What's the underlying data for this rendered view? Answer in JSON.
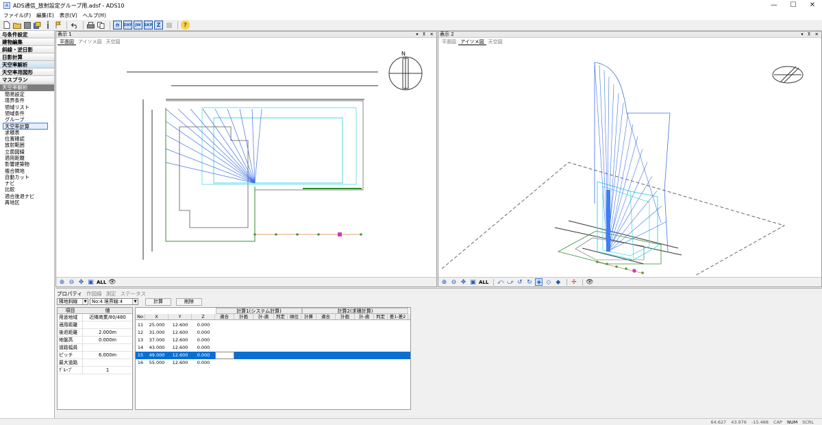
{
  "titlebar": {
    "title": "ADS通信_放射設定グループ用.adsf - ADS10",
    "app_icon": "A",
    "minimize": "—",
    "maximize": "☐",
    "close": "✕"
  },
  "menu": [
    "ファイル(F)",
    "編集(E)",
    "表示(V)",
    "ヘルプ(H)"
  ],
  "toolbar": {
    "icons": [
      "new-file-icon",
      "open-folder-icon",
      "save-icon",
      "save-as-icon",
      "info-icon",
      "flag-icon",
      "undo-icon",
      "print-icon",
      "copy-icon"
    ],
    "format_buttons": [
      "作",
      "DXF",
      "JW",
      "SKP",
      "Z"
    ],
    "help": "?"
  },
  "sidebar": {
    "categories": [
      "与条件設定",
      "建物編集",
      "斜線・逆日影",
      "日影計算",
      "天空率解析",
      "天空率用図形",
      "マスプラン"
    ],
    "active_category": "天空率解析",
    "section_title": "天空率解析",
    "items": [
      "簡易設定",
      "境界条件",
      "領域リスト",
      "領域条件",
      "グループ",
      "天空率計算",
      "求積表",
      "位置確認",
      "放射範囲",
      "立面図線",
      "適用距離",
      "影響建築物",
      "複合隣地",
      "自動カット",
      "ナビ",
      "比較",
      "適合後退ナビ",
      "再地区"
    ],
    "selected_item": "天空率計算"
  },
  "views": [
    {
      "title": "表示 1",
      "tabs": [
        "平面図",
        "アイソメ図",
        "天空図"
      ],
      "active_tab": "平面図",
      "controls": "▾ ⊼ ✕",
      "footer": [
        "zoom-in-icon",
        "zoom-out-icon",
        "pan-icon",
        "fit-icon"
      ],
      "footer_all": "ALL",
      "footer_eye": "eye-icon"
    },
    {
      "title": "表示 2",
      "tabs": [
        "平面図",
        "アイソメ図",
        "天空図"
      ],
      "active_tab": "アイソメ図",
      "controls": "▾ ⊼ ✕",
      "footer_all": "ALL"
    }
  ],
  "compass_label": "N",
  "bottom": {
    "tabs": [
      "プロパティ",
      "作図線",
      "測定",
      "ステータス"
    ],
    "active_tab": "プロパティ",
    "combo1": "隣地斜線",
    "combo2": "No:4 境界線:4",
    "calc_button": "計算",
    "delete_button": "削除",
    "props_header": [
      "項目",
      "値"
    ],
    "props": [
      {
        "k": "用途地域",
        "v": "近隣商業/80/480"
      },
      {
        "k": "適用距離",
        "v": ""
      },
      {
        "k": "後退距離",
        "v": "2.000m"
      },
      {
        "k": "地盤高",
        "v": "0.000m"
      },
      {
        "k": "道路幅員",
        "v": ""
      },
      {
        "k": "ピッチ",
        "v": "6.000m"
      },
      {
        "k": "最大道路",
        "v": ""
      },
      {
        "k": "ｸﾞﾙｰﾌﾟ",
        "v": "1"
      }
    ],
    "grid_groups": [
      "計算1(システム計算)",
      "計算2(求積計算)"
    ],
    "grid_headers": [
      "No",
      "X",
      "Y",
      "Z",
      "適合",
      "計画",
      "計-適",
      "判定",
      "順位",
      "計算",
      "適合",
      "計画",
      "計-適",
      "判定",
      "差1-差2"
    ],
    "grid_rows": [
      [
        "11",
        "25.000",
        "12.600",
        "0.000"
      ],
      [
        "12",
        "31.000",
        "12.600",
        "0.000"
      ],
      [
        "13",
        "37.000",
        "12.600",
        "0.000"
      ],
      [
        "14",
        "43.000",
        "12.600",
        "0.000"
      ],
      [
        "15",
        "49.000",
        "12.600",
        "0.000"
      ],
      [
        "16",
        "55.000",
        "12.600",
        "0.000"
      ]
    ],
    "selected_row_index": 4
  },
  "status": {
    "x": "64.627",
    "y": "43.976",
    "z": "-15.488",
    "cap": "CAP",
    "num": "NUM",
    "scrl": "SCRL"
  },
  "colors": {
    "accent": "#0a6fd1",
    "ray": "#3f6fe6",
    "cyan": "#3fd6e6",
    "green": "#2f8f2f"
  }
}
